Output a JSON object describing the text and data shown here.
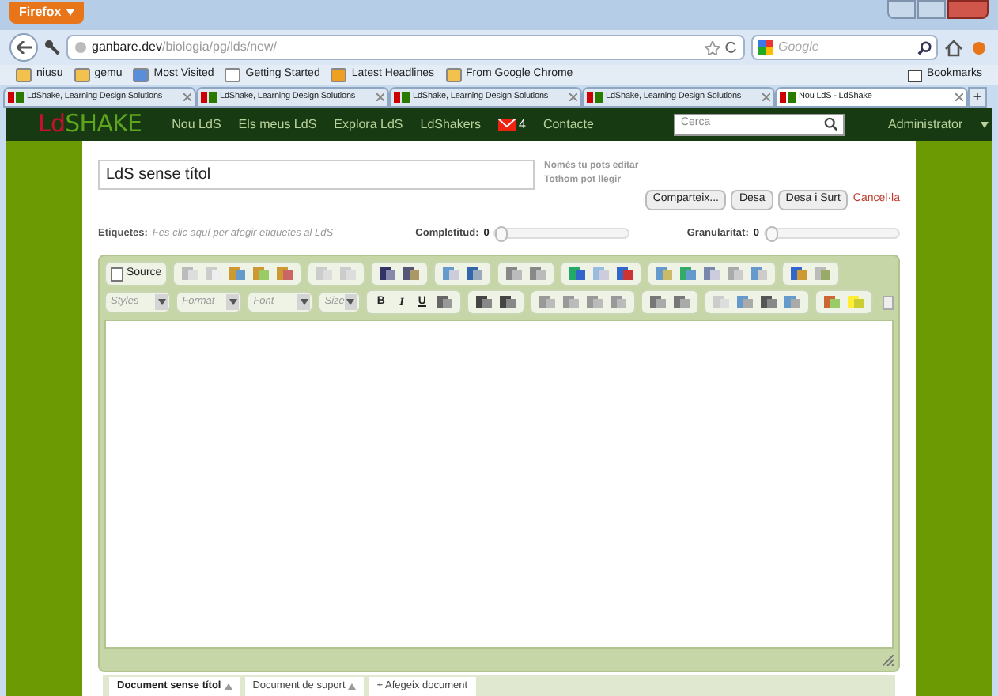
{
  "browser": {
    "menu_button": "Firefox",
    "url_host": "ganbare.dev",
    "url_path": "/biologia/pg/lds/new/",
    "search_placeholder": "Google",
    "bookmarks_button": "Bookmarks",
    "bookmarks": [
      {
        "label": "niusu",
        "kind": "folder"
      },
      {
        "label": "gemu",
        "kind": "folder"
      },
      {
        "label": "Most Visited",
        "kind": "page"
      },
      {
        "label": "Getting Started",
        "kind": "blank"
      },
      {
        "label": "Latest Headlines",
        "kind": "feed"
      },
      {
        "label": "From Google Chrome",
        "kind": "folder"
      }
    ],
    "tabs": [
      {
        "label": "LdShake, Learning Design Solutions",
        "selected": false
      },
      {
        "label": "LdShake, Learning Design Solutions",
        "selected": false
      },
      {
        "label": "LdShake, Learning Design Solutions",
        "selected": false
      },
      {
        "label": "LdShake, Learning Design Solutions",
        "selected": false
      },
      {
        "label": "Nou LdS - LdShake",
        "selected": true
      }
    ],
    "new_tab": "+"
  },
  "site": {
    "logo_prefix": "Ld",
    "logo_rest": "SHAKE",
    "nav": [
      "Nou LdS",
      "Els meus LdS",
      "Explora LdS",
      "LdShakers"
    ],
    "messages_count": "4",
    "contact": "Contacte",
    "search_placeholder": "Cerca",
    "user": "Administrator"
  },
  "form": {
    "title": "LdS sense títol",
    "permissions": [
      "Només tu pots editar",
      "Tothom pot llegir"
    ],
    "buttons": [
      "Comparteix...",
      "Desa",
      "Desa i Surt"
    ],
    "cancel": "Cancel·la",
    "tags_label": "Etiquetes:",
    "tags_placeholder": "Fes clic aquí per afegir etiquetes al LdS",
    "sliders": [
      {
        "label": "Completitud:",
        "reading": "0",
        "level": 0
      },
      {
        "label": "Granularitat:",
        "reading": "0",
        "level": 0
      }
    ]
  },
  "editor": {
    "source": "Source",
    "dropdowns": [
      "Styles",
      "Format",
      "Font",
      "Size"
    ],
    "text_buttons": [
      "B",
      "I",
      "U"
    ],
    "doc_tabs": [
      {
        "label": "Document sense títol",
        "selected": true,
        "kind": "document"
      },
      {
        "label": "Document de suport",
        "selected": false,
        "kind": "document"
      },
      {
        "label": "+ Afegeix document",
        "selected": false,
        "kind": "add"
      }
    ]
  }
}
